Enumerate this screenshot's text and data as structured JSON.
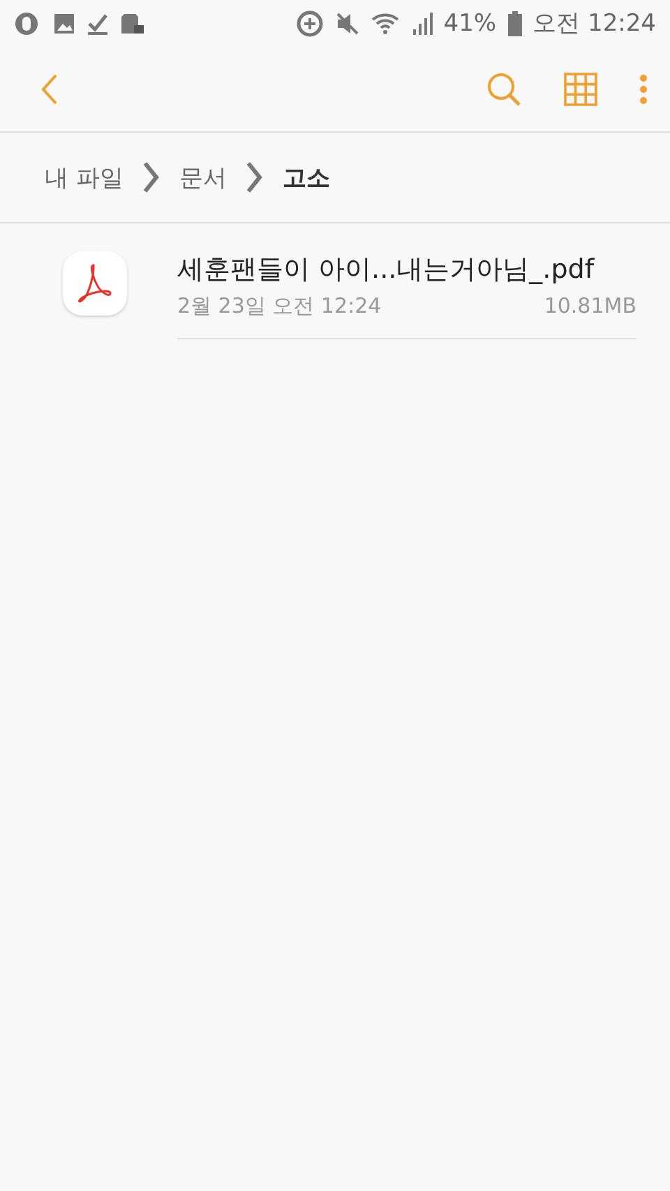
{
  "status_bar": {
    "battery": "41%",
    "time": "오전 12:24"
  },
  "breadcrumbs": [
    {
      "label": "내 파일",
      "selected": false
    },
    {
      "label": "문서",
      "selected": false
    },
    {
      "label": "고소",
      "selected": true
    }
  ],
  "files": [
    {
      "name": "세훈팬들이 아이...내는거아님_.pdf",
      "date": "2월 23일 오전 12:24",
      "size": "10.81MB"
    }
  ]
}
